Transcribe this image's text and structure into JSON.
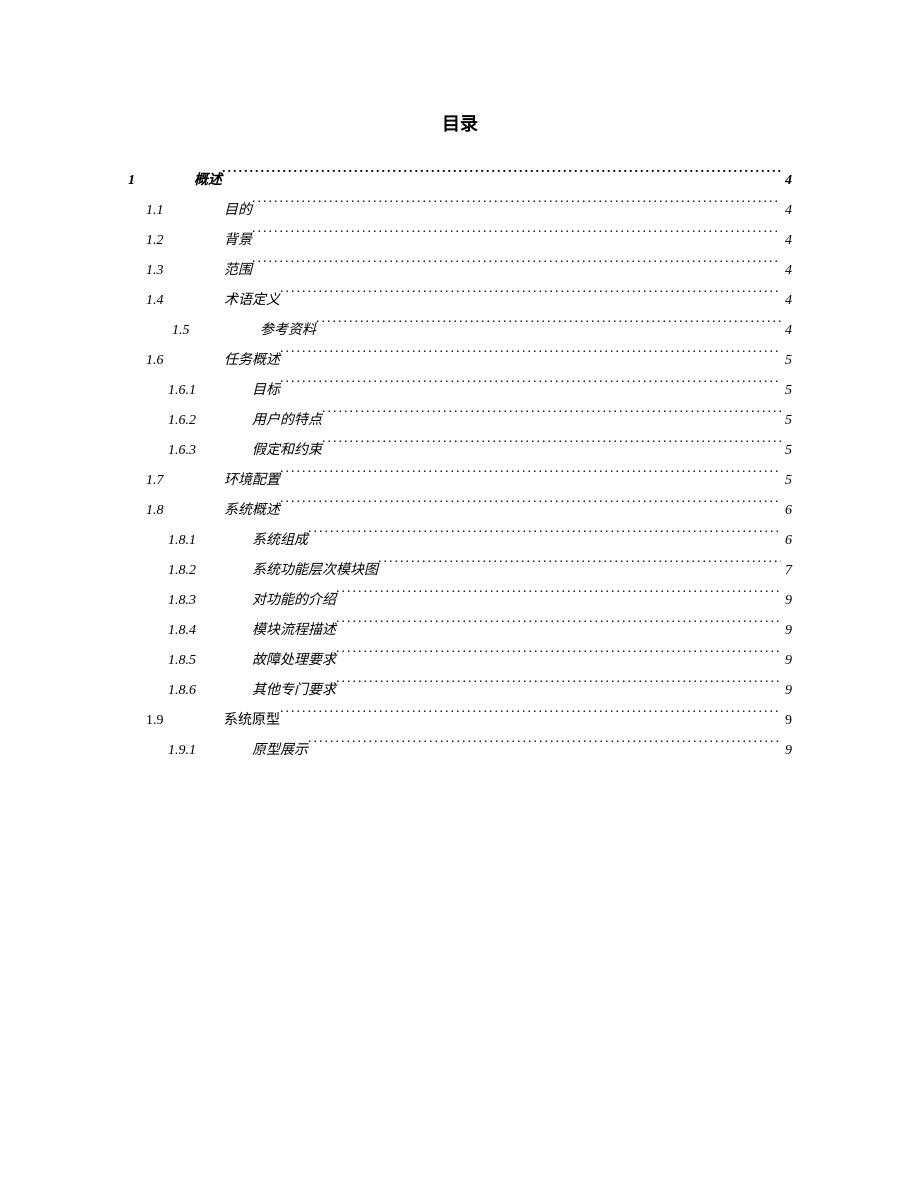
{
  "title": "目录",
  "toc": [
    {
      "level": "lvl-1",
      "num": "1",
      "text": "概述",
      "page": "4"
    },
    {
      "level": "lvl-2",
      "num": "1.1",
      "text": "目的",
      "page": "4"
    },
    {
      "level": "lvl-2",
      "num": "1.2",
      "text": "背景",
      "page": "4"
    },
    {
      "level": "lvl-2",
      "num": "1.3",
      "text": "范围",
      "page": "4"
    },
    {
      "level": "lvl-2",
      "num": "1.4",
      "text": "术语定义",
      "page": "4"
    },
    {
      "level": "lvl-2s",
      "num": "1.5",
      "text": "参考资料",
      "page": "4"
    },
    {
      "level": "lvl-2",
      "num": "1.6",
      "text": "任务概述",
      "page": "5"
    },
    {
      "level": "lvl-3",
      "num": "1.6.1",
      "text": "目标",
      "page": "5"
    },
    {
      "level": "lvl-3",
      "num": "1.6.2",
      "text": "用户的特点",
      "page": "5"
    },
    {
      "level": "lvl-3",
      "num": "1.6.3",
      "text": "假定和约束",
      "page": "5"
    },
    {
      "level": "lvl-2",
      "num": "1.7",
      "text": "环境配置",
      "page": "5"
    },
    {
      "level": "lvl-2",
      "num": "1.8",
      "text": "系统概述",
      "page": "6"
    },
    {
      "level": "lvl-3",
      "num": "1.8.1",
      "text": "系统组成",
      "page": "6"
    },
    {
      "level": "lvl-3",
      "num": "1.8.2",
      "text": "系统功能层次模块图",
      "page": "7"
    },
    {
      "level": "lvl-3",
      "num": "1.8.3",
      "text": "对功能的介绍",
      "page": "9"
    },
    {
      "level": "lvl-3",
      "num": "1.8.4",
      "text": "模块流程描述",
      "page": "9"
    },
    {
      "level": "lvl-3",
      "num": "1.8.5",
      "text": "故障处理要求",
      "page": "9"
    },
    {
      "level": "lvl-3",
      "num": "1.8.6",
      "text": "其他专门要求",
      "page": "9"
    },
    {
      "level": "lvl-2n",
      "num": "1.9",
      "text": "系统原型",
      "page": "9"
    },
    {
      "level": "lvl-3",
      "num": "1.9.1",
      "text": "原型展示",
      "page": "9"
    }
  ]
}
